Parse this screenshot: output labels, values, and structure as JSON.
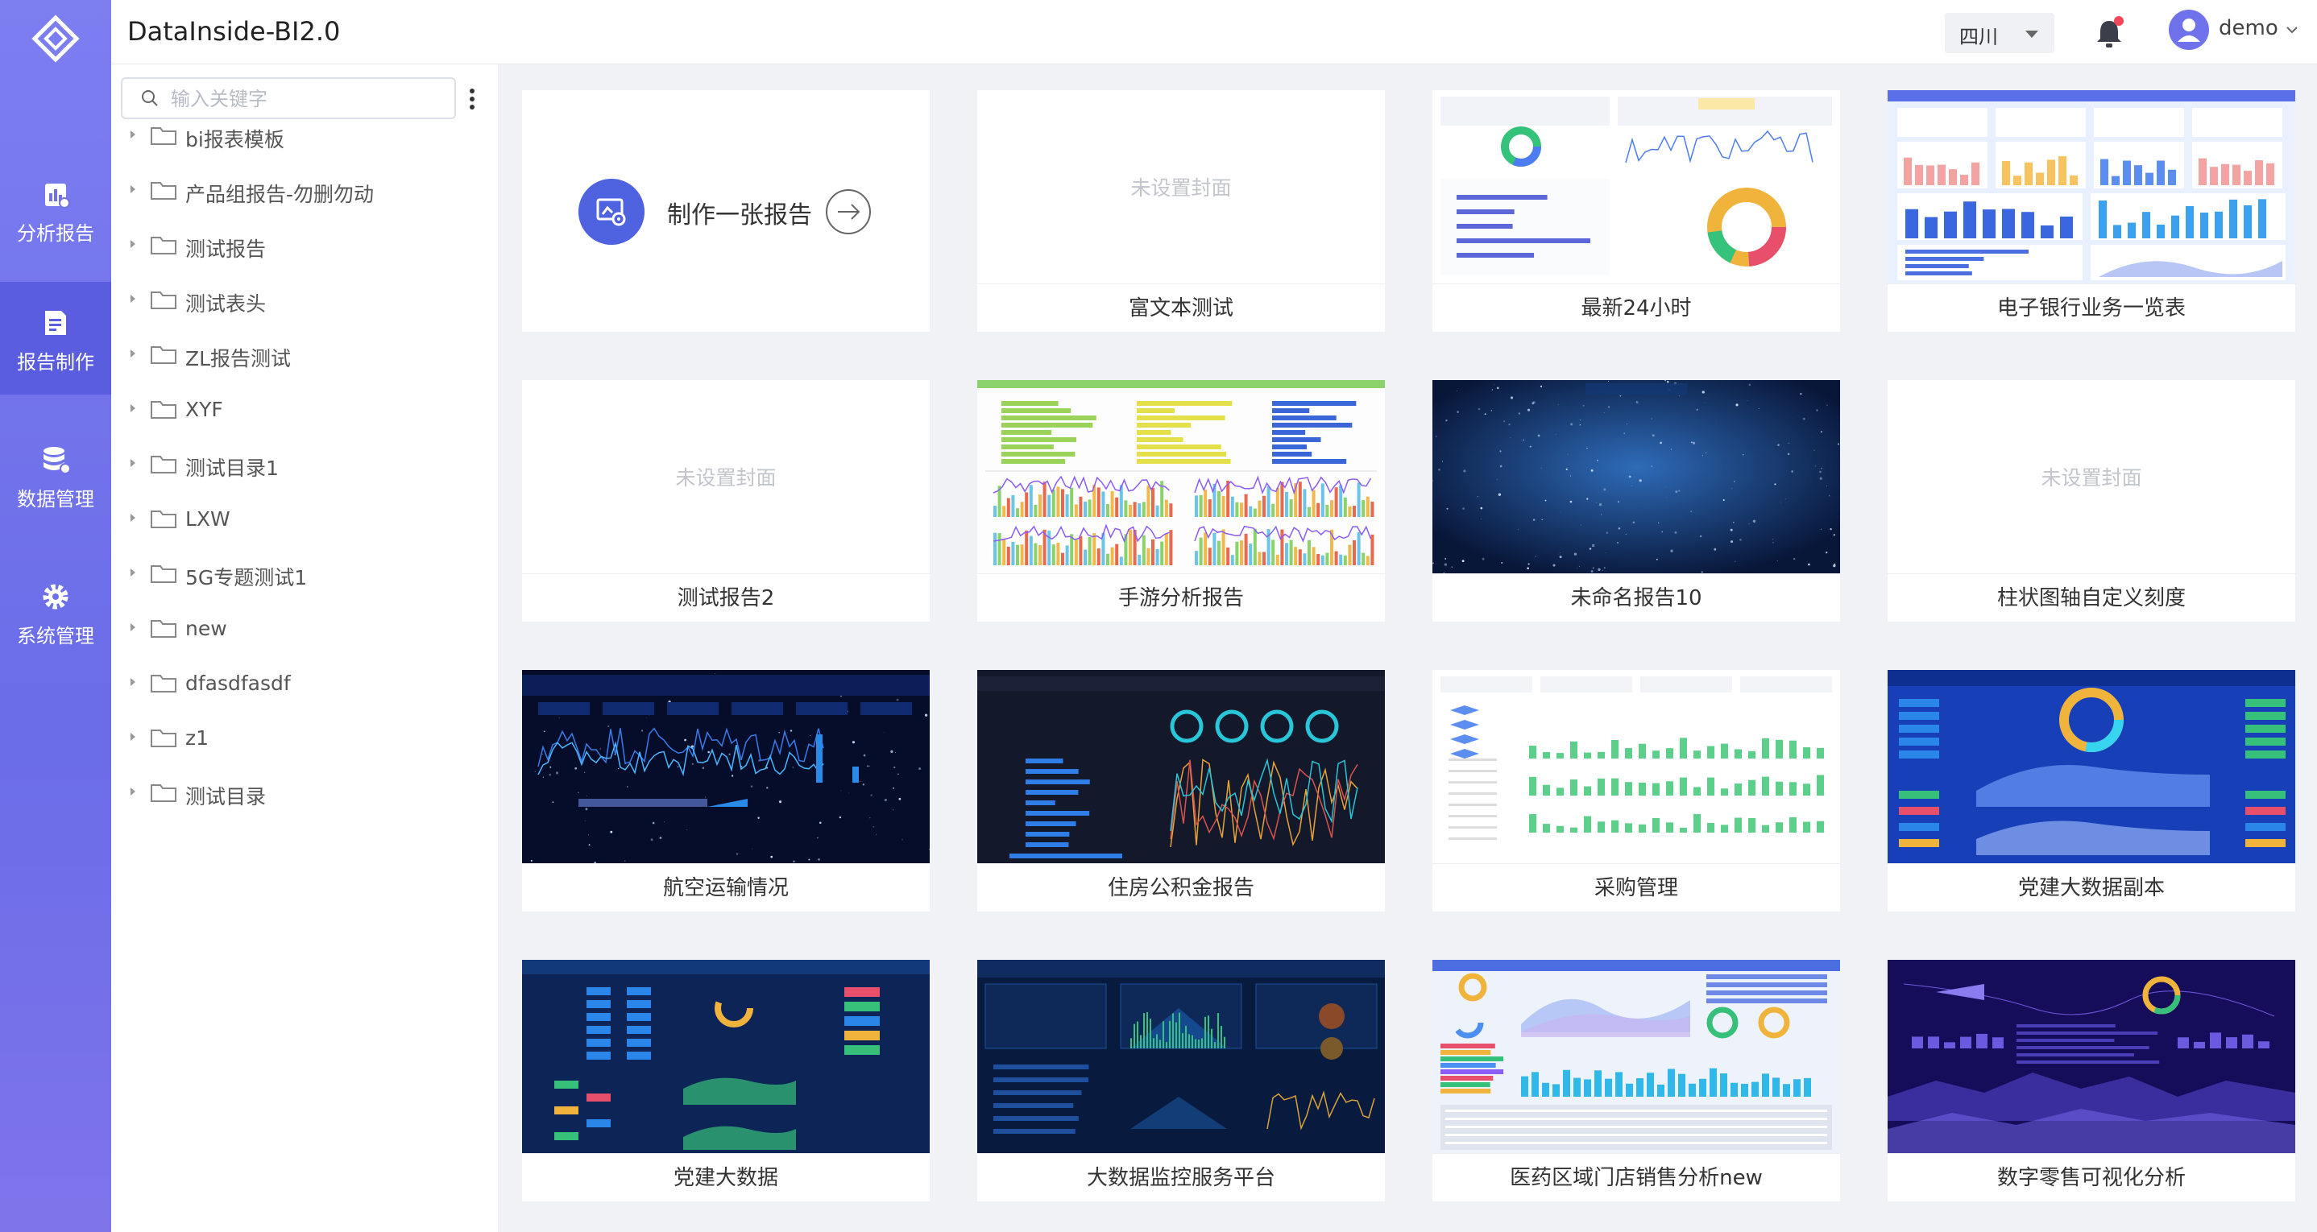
{
  "app": {
    "title": "DataInside-BI2.0"
  },
  "nav": [
    {
      "label": "分析报告",
      "icon": "analysis-report-icon"
    },
    {
      "label": "报告制作",
      "icon": "report-edit-icon",
      "active": true
    },
    {
      "label": "数据管理",
      "icon": "database-icon"
    },
    {
      "label": "系统管理",
      "icon": "gear-icon"
    }
  ],
  "header": {
    "region": "四川",
    "user": "demo"
  },
  "search": {
    "placeholder": "输入关键字"
  },
  "tree": [
    "bi报表模板",
    "产品组报告-勿删勿动",
    "测试报告",
    "测试表头",
    "ZL报告测试",
    "XYF",
    "测试目录1",
    "LXW",
    "5G专题测试1",
    "new",
    "dfasdfasdf",
    "z1",
    "测试目录"
  ],
  "create": {
    "label": "制作一张报告"
  },
  "nocover_text": "未设置封面",
  "cards": [
    {
      "title": "富文本测试",
      "thumb": "none"
    },
    {
      "title": "最新24小时",
      "thumb": "light"
    },
    {
      "title": "电子银行业务一览表",
      "thumb": "blue-light"
    },
    {
      "title": "测试报告2",
      "thumb": "none"
    },
    {
      "title": "手游分析报告",
      "thumb": "light-bars"
    },
    {
      "title": "未命名报告10",
      "thumb": "space"
    },
    {
      "title": "柱状图轴自定义刻度",
      "thumb": "none"
    },
    {
      "title": "航空运输情况",
      "thumb": "dark-space"
    },
    {
      "title": "住房公积金报告",
      "thumb": "dark"
    },
    {
      "title": "采购管理",
      "thumb": "light-green"
    },
    {
      "title": "党建大数据副本",
      "thumb": "blue-dash"
    },
    {
      "title": "党建大数据",
      "thumb": "dark-blue"
    },
    {
      "title": "大数据监控服务平台",
      "thumb": "dark-blue2"
    },
    {
      "title": "医药区域门店销售分析new",
      "thumb": "light-blue"
    },
    {
      "title": "数字零售可视化分析",
      "thumb": "purple"
    }
  ],
  "colors": {
    "nav": "#6a6ce8",
    "nav_active": "#5b5de0",
    "accent": "#4f63e0",
    "badge": "#f5475c"
  }
}
